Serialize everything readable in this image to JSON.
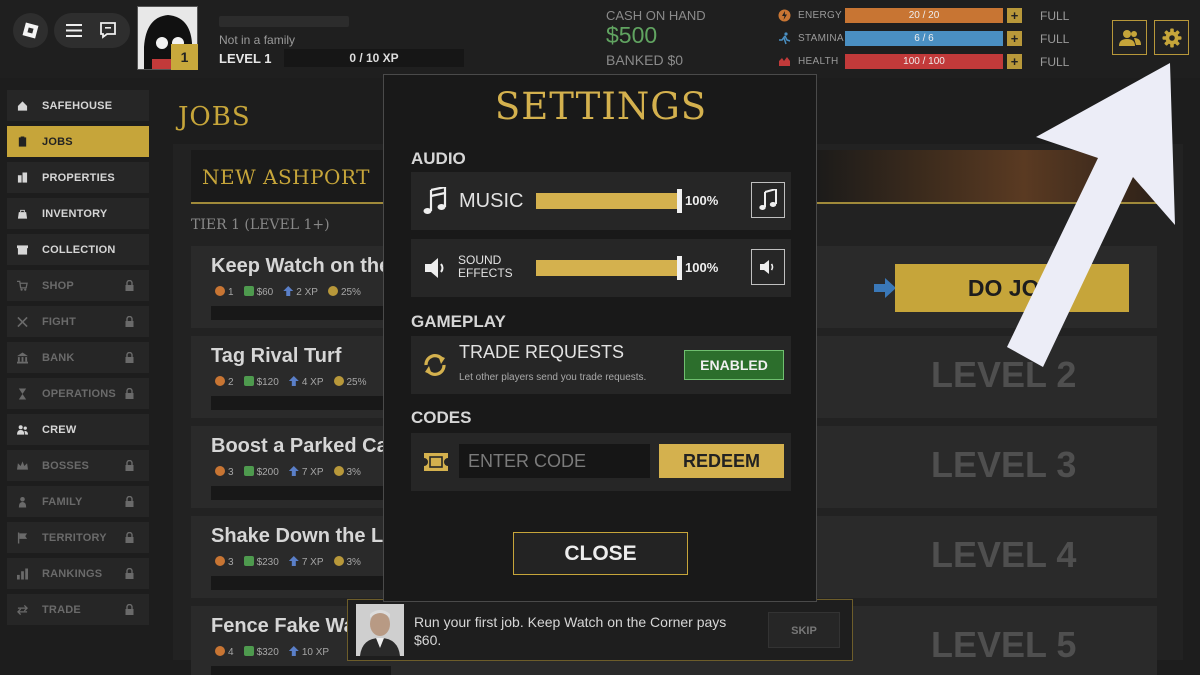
{
  "colors": {
    "gold": "#c6a53a",
    "cash_green": "#61a461",
    "energy": "#c87533",
    "stamina": "#4a8fc2",
    "health": "#c23a3a",
    "enabled_green": "#2c6e2c"
  },
  "player": {
    "family": "Not in a family",
    "level_badge": "1",
    "level_label": "LEVEL 1",
    "xp": "0 / 10 XP"
  },
  "money": {
    "cash_label": "CASH ON HAND",
    "cash": "$500",
    "banked": "BANKED $0"
  },
  "stats": [
    {
      "name": "ENERGY",
      "value": "20 / 20",
      "fraction": 1.0,
      "color": "#c87533",
      "plus": "+",
      "status": "FULL",
      "icon": "energy-icon"
    },
    {
      "name": "STAMINA",
      "value": "6 / 6",
      "fraction": 1.0,
      "color": "#4a8fc2",
      "plus": "+",
      "status": "FULL",
      "icon": "stamina-icon"
    },
    {
      "name": "HEALTH",
      "value": "100 / 100",
      "fraction": 1.0,
      "color": "#c23a3a",
      "plus": "+",
      "status": "FULL",
      "icon": "health-icon"
    }
  ],
  "sidebar": {
    "items": [
      {
        "label": "SAFEHOUSE",
        "icon": "house-icon",
        "active": false,
        "locked": false
      },
      {
        "label": "JOBS",
        "icon": "clipboard-icon",
        "active": true,
        "locked": false
      },
      {
        "label": "PROPERTIES",
        "icon": "buildings-icon",
        "active": false,
        "locked": false
      },
      {
        "label": "INVENTORY",
        "icon": "bag-icon",
        "active": false,
        "locked": false
      },
      {
        "label": "COLLECTION",
        "icon": "box-icon",
        "active": false,
        "locked": false
      },
      {
        "label": "SHOP",
        "icon": "cart-icon",
        "active": false,
        "locked": true
      },
      {
        "label": "FIGHT",
        "icon": "crossed-swords-icon",
        "active": false,
        "locked": true
      },
      {
        "label": "BANK",
        "icon": "bank-icon",
        "active": false,
        "locked": true
      },
      {
        "label": "OPERATIONS",
        "icon": "hourglass-icon",
        "active": false,
        "locked": true
      },
      {
        "label": "CREW",
        "icon": "people-icon",
        "active": false,
        "locked": false
      },
      {
        "label": "BOSSES",
        "icon": "crown-icon",
        "active": false,
        "locked": true
      },
      {
        "label": "FAMILY",
        "icon": "person-icon",
        "active": false,
        "locked": true
      },
      {
        "label": "TERRITORY",
        "icon": "flag-icon",
        "active": false,
        "locked": true
      },
      {
        "label": "RANKINGS",
        "icon": "chart-icon",
        "active": false,
        "locked": true
      },
      {
        "label": "TRADE",
        "icon": "swap-icon",
        "active": false,
        "locked": true
      }
    ]
  },
  "jobs": {
    "title": "JOBS",
    "city": "NEW ASHPORT",
    "tier": "TIER 1  (LEVEL 1+)",
    "do_job": "DO JOB",
    "rows": [
      {
        "title": "Keep Watch on the Corner",
        "energy": "1",
        "cash": "$60",
        "xp": "2 XP",
        "pct": "25%",
        "level": ""
      },
      {
        "title": "Tag Rival Turf",
        "energy": "2",
        "cash": "$120",
        "xp": "4 XP",
        "pct": "25%",
        "level": "LEVEL 2"
      },
      {
        "title": "Boost a Parked Car",
        "energy": "3",
        "cash": "$200",
        "xp": "7 XP",
        "pct": "3%",
        "level": "LEVEL 3"
      },
      {
        "title": "Shake Down the Local",
        "energy": "3",
        "cash": "$230",
        "xp": "7 XP",
        "pct": "3%",
        "level": "LEVEL 4"
      },
      {
        "title": "Fence Fake Watches",
        "energy": "4",
        "cash": "$320",
        "xp": "10 XP",
        "pct": "",
        "level": "LEVEL 5"
      }
    ]
  },
  "tutorial": {
    "message": "Run your first job. Keep Watch on the Corner pays $60.",
    "skip": "SKIP"
  },
  "settings": {
    "title": "SETTINGS",
    "audio_header": "AUDIO",
    "music_label": "MUSIC",
    "music_volume": "100%",
    "music_fraction": 1.0,
    "sfx_label_1": "SOUND",
    "sfx_label_2": "EFFECTS",
    "sfx_volume": "100%",
    "sfx_fraction": 1.0,
    "gameplay_header": "GAMEPLAY",
    "trade_title": "TRADE REQUESTS",
    "trade_desc": "Let other players send you trade requests.",
    "trade_state": "ENABLED",
    "codes_header": "CODES",
    "code_placeholder": "ENTER CODE",
    "redeem": "REDEEM",
    "close": "CLOSE"
  }
}
